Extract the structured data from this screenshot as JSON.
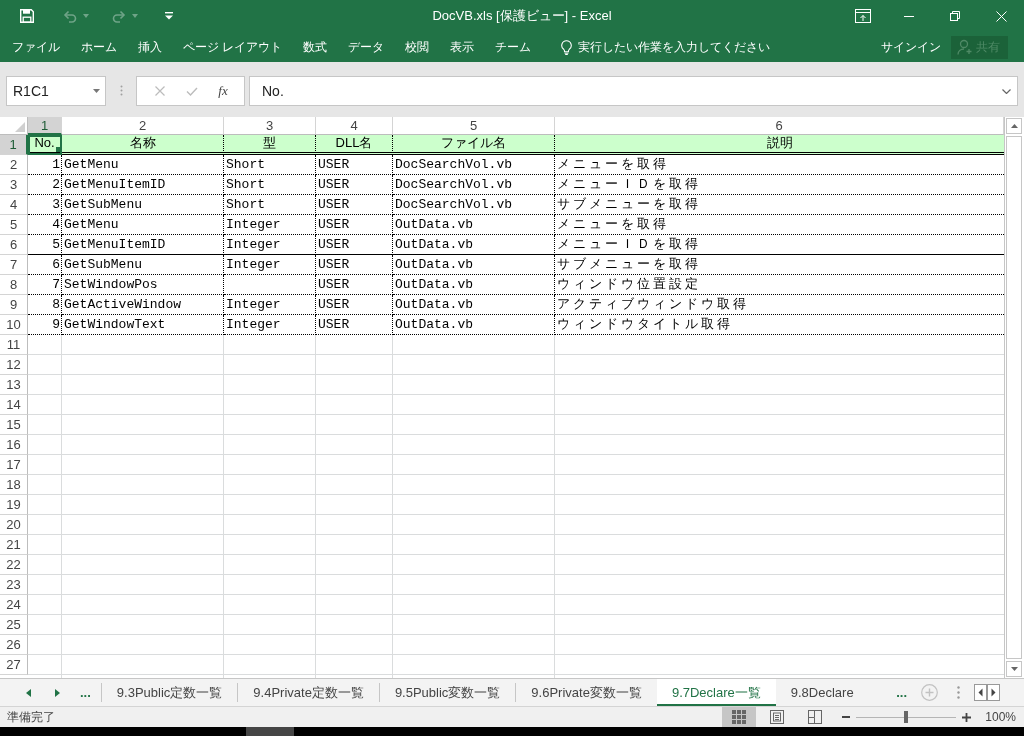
{
  "window": {
    "title": "DocVB.xls [保護ビュー] - Excel"
  },
  "quick_access": [
    {
      "kind": "save",
      "disabled": false
    },
    {
      "kind": "undo",
      "disabled": true
    },
    {
      "kind": "redo",
      "disabled": true
    },
    {
      "kind": "customize",
      "disabled": false
    }
  ],
  "ribbon_tabs": [
    "ファイル",
    "ホーム",
    "挿入",
    "ページ レイアウト",
    "数式",
    "データ",
    "校閲",
    "表示",
    "チーム"
  ],
  "tell_me": {
    "placeholder": "実行したい作業を入力してください"
  },
  "account": {
    "sign_in": "サインイン",
    "share": {
      "label": "共有",
      "disabled": true
    }
  },
  "name_box": {
    "value": "R1C1"
  },
  "formula_buttons": [
    {
      "kind": "cancel",
      "disabled": true
    },
    {
      "kind": "enter",
      "disabled": true
    },
    {
      "kind": "function",
      "label": "fx",
      "disabled": false
    }
  ],
  "formula_bar": {
    "value": "No."
  },
  "sheet": {
    "columns": [
      {
        "label": "1",
        "selected": true
      },
      {
        "label": "2",
        "selected": false
      },
      {
        "label": "3",
        "selected": false
      },
      {
        "label": "4",
        "selected": false
      },
      {
        "label": "5",
        "selected": false
      },
      {
        "label": "6",
        "selected": false
      }
    ],
    "header_row": {
      "number": "1",
      "selected": true,
      "cells": [
        "No.",
        "名称",
        "型",
        "DLL名",
        "ファイル名",
        "説明"
      ]
    },
    "rows": [
      {
        "number": "2",
        "selected": false,
        "rule_below": false,
        "no": "1",
        "name": "GetMenu",
        "type": "Short",
        "dll": "USER",
        "file": "DocSearchVol.vb",
        "description": "メニューを取得"
      },
      {
        "number": "3",
        "selected": false,
        "rule_below": false,
        "no": "2",
        "name": "GetMenuItemID",
        "type": "Short",
        "dll": "USER",
        "file": "DocSearchVol.vb",
        "description": "メニューＩＤを取得"
      },
      {
        "number": "4",
        "selected": false,
        "rule_below": false,
        "no": "3",
        "name": "GetSubMenu",
        "type": "Short",
        "dll": "USER",
        "file": "DocSearchVol.vb",
        "description": "サブメニューを取得"
      },
      {
        "number": "5",
        "selected": false,
        "rule_below": false,
        "no": "4",
        "name": "GetMenu",
        "type": "Integer",
        "dll": "USER",
        "file": "OutData.vb",
        "description": "メニューを取得"
      },
      {
        "number": "6",
        "selected": false,
        "rule_below": true,
        "no": "5",
        "name": "GetMenuItemID",
        "type": "Integer",
        "dll": "USER",
        "file": "OutData.vb",
        "description": "メニューＩＤを取得"
      },
      {
        "number": "7",
        "selected": false,
        "rule_below": false,
        "no": "6",
        "name": "GetSubMenu",
        "type": "Integer",
        "dll": "USER",
        "file": "OutData.vb",
        "description": "サブメニューを取得"
      },
      {
        "number": "8",
        "selected": false,
        "rule_below": false,
        "no": "7",
        "name": "SetWindowPos",
        "dll": "USER",
        "file": "OutData.vb",
        "description": "ウィンドウ位置設定"
      },
      {
        "number": "9",
        "selected": false,
        "rule_below": false,
        "no": "8",
        "name": "GetActiveWindow",
        "type": "Integer",
        "dll": "USER",
        "file": "OutData.vb",
        "description": "アクティブウィンドウ取得"
      },
      {
        "number": "10",
        "selected": false,
        "rule_below": false,
        "no": "9",
        "name": "GetWindowText",
        "type": "Integer",
        "dll": "USER",
        "file": "OutData.vb",
        "description": "ウィンドウタイトル取得"
      }
    ],
    "empty_rows": [
      {
        "number": "11",
        "selected": false
      },
      {
        "number": "12",
        "selected": false
      },
      {
        "number": "13",
        "selected": false
      },
      {
        "number": "14",
        "selected": false
      },
      {
        "number": "15",
        "selected": false
      },
      {
        "number": "16",
        "selected": false
      },
      {
        "number": "17",
        "selected": false
      },
      {
        "number": "18",
        "selected": false
      },
      {
        "number": "19",
        "selected": false
      },
      {
        "number": "20",
        "selected": false
      },
      {
        "number": "21",
        "selected": false
      },
      {
        "number": "22",
        "selected": false
      },
      {
        "number": "23",
        "selected": false
      },
      {
        "number": "24",
        "selected": false
      },
      {
        "number": "25",
        "selected": false
      },
      {
        "number": "26",
        "selected": false
      },
      {
        "number": "27",
        "selected": false
      }
    ]
  },
  "sheet_tabs": {
    "leading_more": "...",
    "tabs": [
      {
        "label": "9.3Public定数一覧",
        "selected": false
      },
      {
        "label": "9.4Private定数一覧",
        "selected": false
      },
      {
        "label": "9.5Public変数一覧",
        "selected": false
      },
      {
        "label": "9.6Private変数一覧",
        "selected": false
      },
      {
        "label": "9.7Declare一覧",
        "selected": true
      },
      {
        "label": "9.8Declare",
        "selected": false
      }
    ],
    "trailing_more": "..."
  },
  "status_bar": {
    "status": "準備完了",
    "views": [
      {
        "kind": "normal",
        "selected": true
      },
      {
        "kind": "page_layout",
        "selected": false
      },
      {
        "kind": "page_break",
        "selected": false
      }
    ],
    "zoom": {
      "level": 0.5,
      "reading": "100%"
    }
  }
}
